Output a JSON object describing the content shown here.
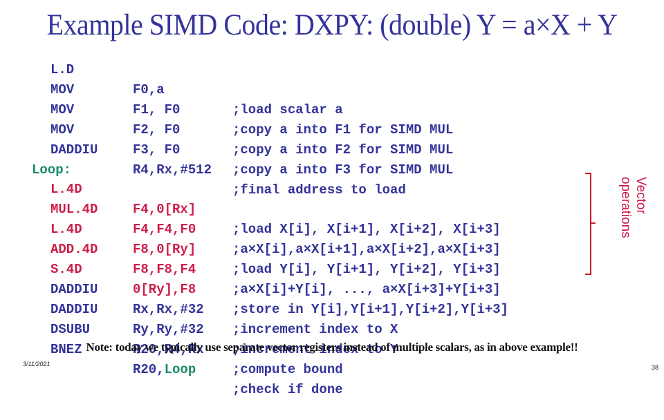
{
  "slide": {
    "title": "Example SIMD Code: DXPY:  (double) Y = a×X + Y",
    "setup": [
      {
        "op": "L.D",
        "args": "F0,a",
        "comment": ";load scalar a"
      },
      {
        "op": "MOV",
        "args": "F1, F0",
        "comment": ";copy a into F1 for SIMD MUL"
      },
      {
        "op": "MOV",
        "args": "F2, F0",
        "comment": ";copy a into F2 for SIMD MUL"
      },
      {
        "op": "MOV",
        "args": "F3, F0",
        "comment": ";copy a into F3 for SIMD MUL"
      },
      {
        "op": "DADDIU",
        "args": "R4,Rx,#512",
        "comment": ";final address to load"
      }
    ],
    "loop_label": "Loop:",
    "loop": [
      {
        "op": "L.4D",
        "args": "F4,0[Rx]",
        "comment": ";load X[i], X[i+1], X[i+2], X[i+3]"
      },
      {
        "op": "MUL.4D",
        "args": "F4,F4,F0",
        "comment": ";a×X[i],a×X[i+1],a×X[i+2],a×X[i+3]"
      },
      {
        "op": "L.4D",
        "args": "F8,0[Ry]",
        "comment": ";load Y[i], Y[i+1], Y[i+2], Y[i+3]"
      },
      {
        "op": "ADD.4D",
        "args": "F8,F8,F4",
        "comment": ";a×X[i]+Y[i], ..., a×X[i+3]+Y[i+3]"
      },
      {
        "op": "S.4D",
        "args": "0[Ry],F8",
        "comment": ";store in Y[i],Y[i+1],Y[i+2],Y[i+3]"
      },
      {
        "op": "DADDIU",
        "args": "Rx,Rx,#32",
        "comment": ";increment index to X"
      },
      {
        "op": "DADDIU",
        "args": "Ry,Ry,#32",
        "comment": ";increment index to Y"
      },
      {
        "op": "DSUBU",
        "args": "R20,R4,Rx",
        "comment": ";compute bound"
      },
      {
        "op": "BNEZ",
        "args_reg": "R20,",
        "args_label": "Loop",
        "comment": ";check if done"
      }
    ],
    "bracket_label": "Vector operations",
    "note": "Note: today we typically use separate vector registers instead of multiple scalars, as in above example!!",
    "date": "3/11/2021",
    "page_number": "38",
    "colors": {
      "title": "#33339a",
      "instruction": "#33339a",
      "vector_instruction": "#cc1f4a",
      "label": "#1a8a6a",
      "bracket": "#cc1a2a"
    }
  }
}
